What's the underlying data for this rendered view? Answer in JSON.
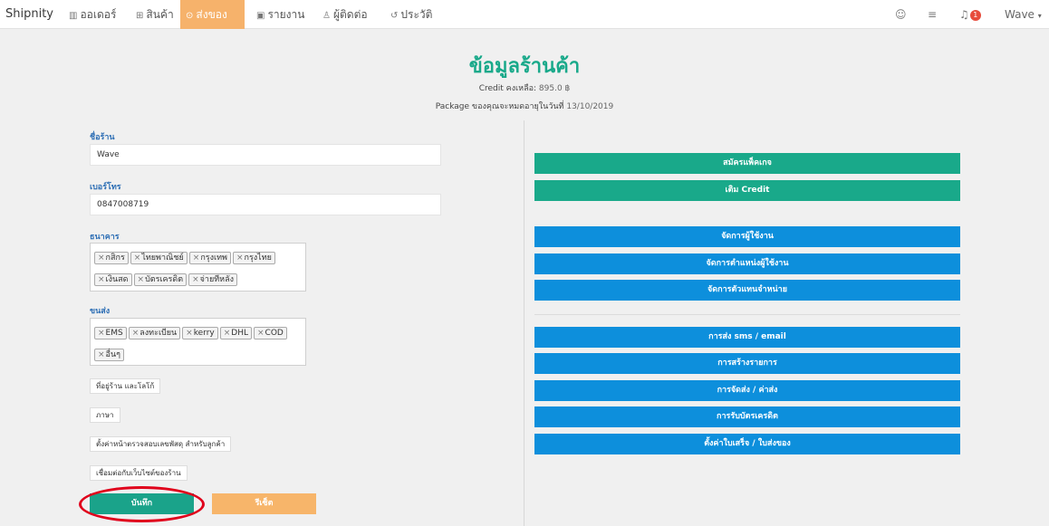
{
  "nav": {
    "brand": "Shipnity",
    "items": [
      {
        "label": "ออเดอร์",
        "icon": "▥"
      },
      {
        "label": "สินค้า",
        "icon": "⊞"
      },
      {
        "label": "ส่งของ",
        "icon": "⊙"
      },
      {
        "label": "รายงาน",
        "icon": "▣"
      },
      {
        "label": "ผู้ติดต่อ",
        "icon": "♙"
      },
      {
        "label": "ประวัติ",
        "icon": "↺"
      }
    ],
    "chat_icon": "☺",
    "settings_icon": "≡",
    "bell_icon": "♫",
    "notification_count": "1",
    "user": "Wave",
    "user_caret": "▾"
  },
  "header": {
    "title": "ข้อมูลร้านค้า",
    "credit_label": "Credit คงเหลือ:",
    "credit_value": "895.0 ฿",
    "package_label": "Package ของคุณจะหมดอายุในวันที่",
    "package_date": "13/10/2019"
  },
  "form": {
    "shop_name_label": "ชื่อร้าน",
    "shop_name_value": "Wave",
    "phone_label": "เบอร์โทร",
    "phone_value": "0847008719",
    "bank_label": "ธนาคาร",
    "bank_tags": [
      "กสิกร",
      "ไทยพาณิชย์",
      "กรุงเทพ",
      "กรุงไทย",
      "เงินสด",
      "บัตรเครดิต",
      "จ่ายทีหลัง"
    ],
    "shipping_label": "ขนส่ง",
    "shipping_tags": [
      "EMS",
      "ลงทะเบียน",
      "kerry",
      "DHL",
      "COD",
      "อื่นๆ"
    ],
    "tag_remove": "×",
    "address_logo_button": "ที่อยู่ร้าน และโลโก้",
    "language_button": "ภาษา",
    "tracking_page_button": "ตั้งค่าหน้าตรวจสอบเลขพัสดุ สำหรับลูกค้า",
    "connect_website_button": "เชื่อมต่อกับเว็บไซต์ของร้าน",
    "save_button": "บันทึก",
    "reset_button": "รีเซ็ต"
  },
  "actions": {
    "group1": [
      "สมัครแพ็คเกจ",
      "เติม Credit"
    ],
    "group2": [
      "จัดการผู้ใช้งาน",
      "จัดการตำแหน่งผู้ใช้งาน",
      "จัดการตัวแทนจำหน่าย"
    ],
    "group3": [
      "การส่ง sms / email",
      "การสร้างรายการ",
      "การจัดส่ง / ค่าส่ง",
      "การรับบัตรเครดิต",
      "ตั้งค่าใบเสร็จ / ใบส่งของ"
    ]
  },
  "colors": {
    "accent_green": "#19a98a",
    "active_tab": "#f6b26b",
    "blue": "#0d8fdc",
    "highlight": "#e0001b"
  }
}
